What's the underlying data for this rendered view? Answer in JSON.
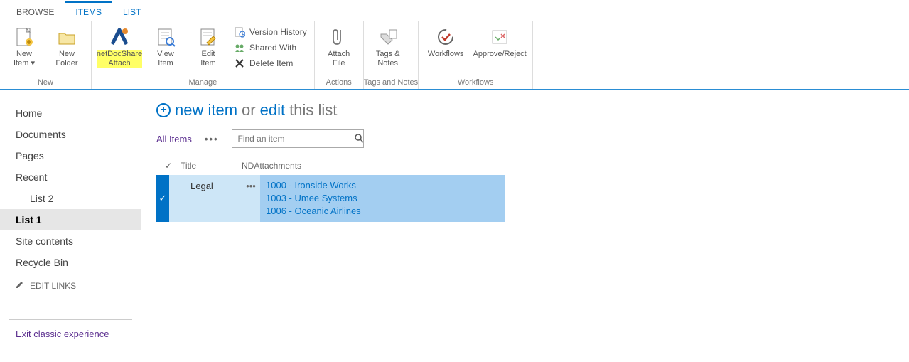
{
  "tabs": {
    "browse": "BROWSE",
    "items": "ITEMS",
    "list": "LIST"
  },
  "ribbon": {
    "new": {
      "label": "New",
      "newItem": {
        "line1": "New",
        "line2": "Item ▾"
      },
      "newFolder": {
        "line1": "New",
        "line2": "Folder"
      }
    },
    "manage": {
      "label": "Manage",
      "nds": {
        "line1": "netDocShare",
        "line2": "Attach"
      },
      "view": {
        "line1": "View",
        "line2": "Item"
      },
      "edit": {
        "line1": "Edit",
        "line2": "Item"
      },
      "version": "Version History",
      "shared": "Shared With",
      "delete": "Delete Item"
    },
    "actions": {
      "label": "Actions",
      "attach": {
        "line1": "Attach",
        "line2": "File"
      }
    },
    "tags": {
      "label": "Tags and Notes",
      "tn": {
        "line1": "Tags &",
        "line2": "Notes"
      }
    },
    "workflows": {
      "label": "Workflows",
      "wf": "Workflows",
      "ar": "Approve/Reject"
    }
  },
  "sidebar": {
    "items": [
      {
        "label": "Home"
      },
      {
        "label": "Documents"
      },
      {
        "label": "Pages"
      },
      {
        "label": "Recent"
      },
      {
        "label": "List 2"
      },
      {
        "label": "List 1"
      },
      {
        "label": "Site contents"
      },
      {
        "label": "Recycle Bin"
      }
    ],
    "editLinks": "EDIT LINKS",
    "exit": "Exit classic experience"
  },
  "content": {
    "newItem": "new item",
    "or": "or",
    "edit": "edit",
    "thisList": "this list",
    "view": "All Items",
    "searchPlaceholder": "Find an item",
    "cols": {
      "check": "✓",
      "title": "Title",
      "att": "NDAttachments"
    },
    "rows": [
      {
        "title": "Legal",
        "attachments": [
          "1000 - Ironside Works",
          "1003 - Umee Systems",
          "1006 - Oceanic Airlines"
        ]
      }
    ]
  }
}
